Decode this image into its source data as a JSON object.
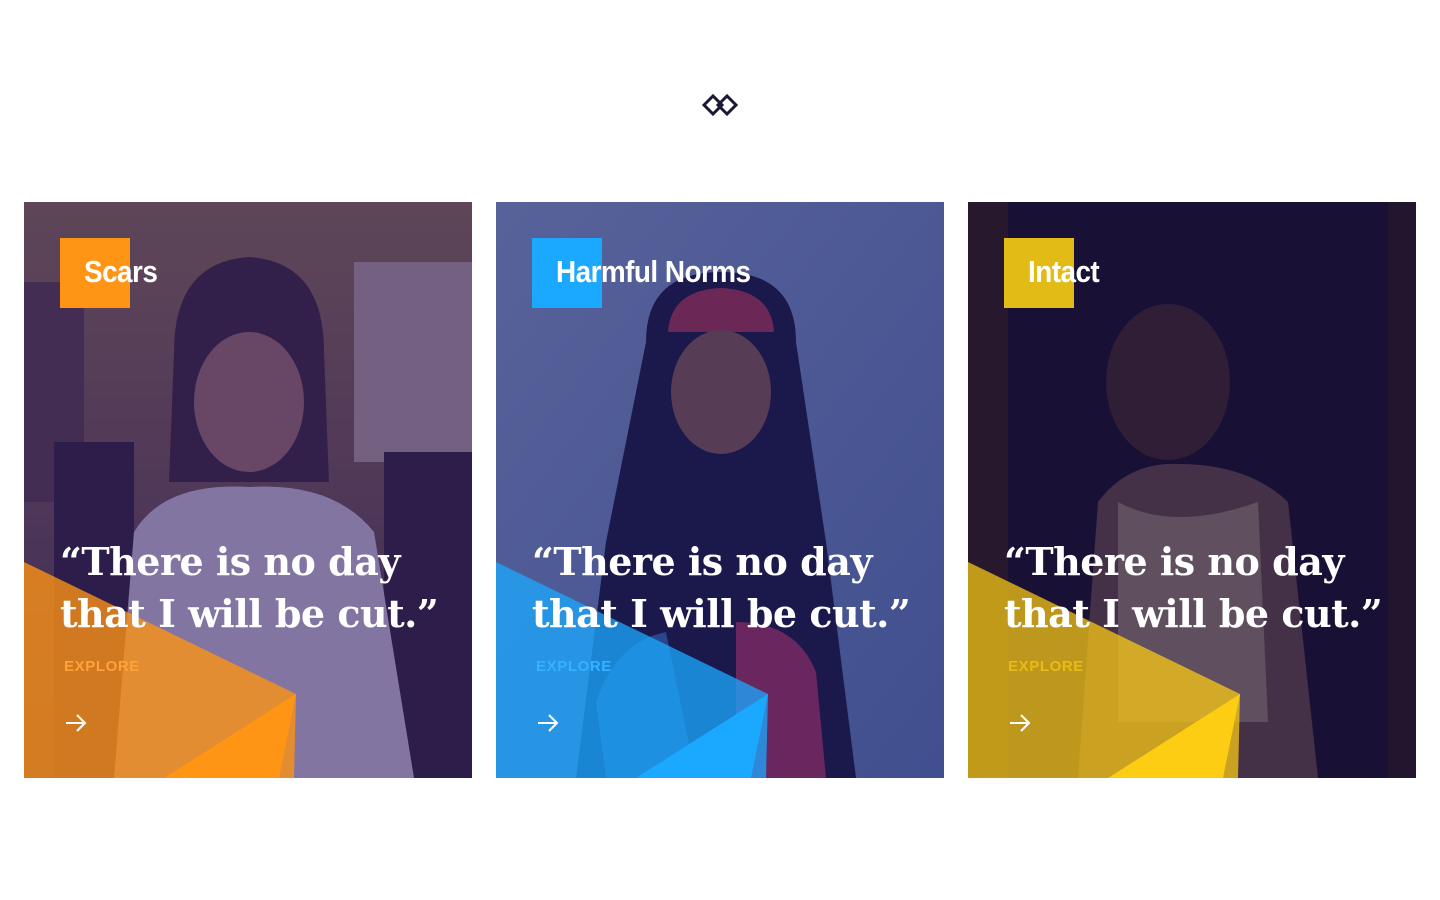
{
  "logo": {
    "icon": "interlocked-diamonds-icon",
    "color": "#1d1836"
  },
  "cards": [
    {
      "tag": "Scars",
      "quote": "“There is no day that I will be cut.”",
      "cta": "EXPLORE",
      "accent": "#ff9415",
      "cta_color": "#ffa23a",
      "icon": "arrow-right-icon"
    },
    {
      "tag": "Harmful Norms",
      "quote": "“There is no day that I will be cut.”",
      "cta": "EXPLORE",
      "accent": "#1ba9ff",
      "cta_color": "#35b2ff",
      "icon": "arrow-right-icon"
    },
    {
      "tag": "Intact",
      "quote": "“There is no day that I will be cut.”",
      "cta": "EXPLORE",
      "accent": "#fdcd14",
      "cta_color": "#e9bb14",
      "icon": "arrow-right-icon"
    }
  ]
}
